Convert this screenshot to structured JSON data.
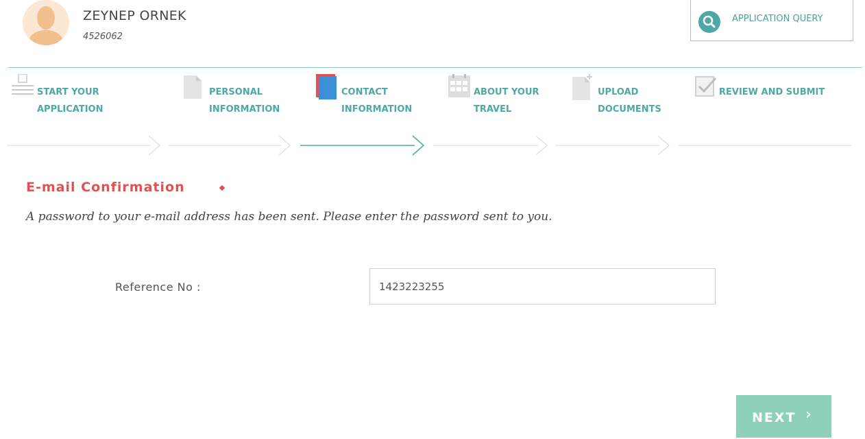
{
  "header": {
    "user_name": "ZEYNEP ORNEK",
    "user_id": "4526062",
    "query_button_label": "APPLICATION QUERY",
    "avatar_icon": "user-avatar-icon",
    "query_icon": "search-icon"
  },
  "steps": [
    {
      "label_line1": "START YOUR",
      "label_line2": "APPLICATION",
      "icon": "list-icon",
      "state": "inactive"
    },
    {
      "label_line1": "PERSONAL",
      "label_line2": "INFORMATION",
      "icon": "document-icon",
      "state": "inactive"
    },
    {
      "label_line1": "CONTACT",
      "label_line2": "INFORMATION",
      "icon": "contact-book-icon",
      "state": "active"
    },
    {
      "label_line1": "ABOUT YOUR",
      "label_line2": "TRAVEL",
      "icon": "calendar-icon",
      "state": "inactive"
    },
    {
      "label_line1": "UPLOAD",
      "label_line2": "DOCUMENTS",
      "icon": "upload-document-icon",
      "state": "inactive"
    },
    {
      "label_line1": "REVIEW AND SUBMIT",
      "label_line2": "",
      "icon": "checkbox-icon",
      "state": "inactive"
    }
  ],
  "section": {
    "title": "E-mail Confirmation",
    "description": "A password to your e-mail address has been sent. Please enter the password sent to you."
  },
  "form": {
    "reference_label": "Reference No :",
    "reference_value": "1423223255"
  },
  "actions": {
    "next_label": "NEXT",
    "next_chevron": "›"
  },
  "colors": {
    "accent_teal": "#4ea8a4",
    "required_red": "#e05252",
    "next_button": "#8fd1b7",
    "active_step_blue": "#3b8fd9"
  }
}
